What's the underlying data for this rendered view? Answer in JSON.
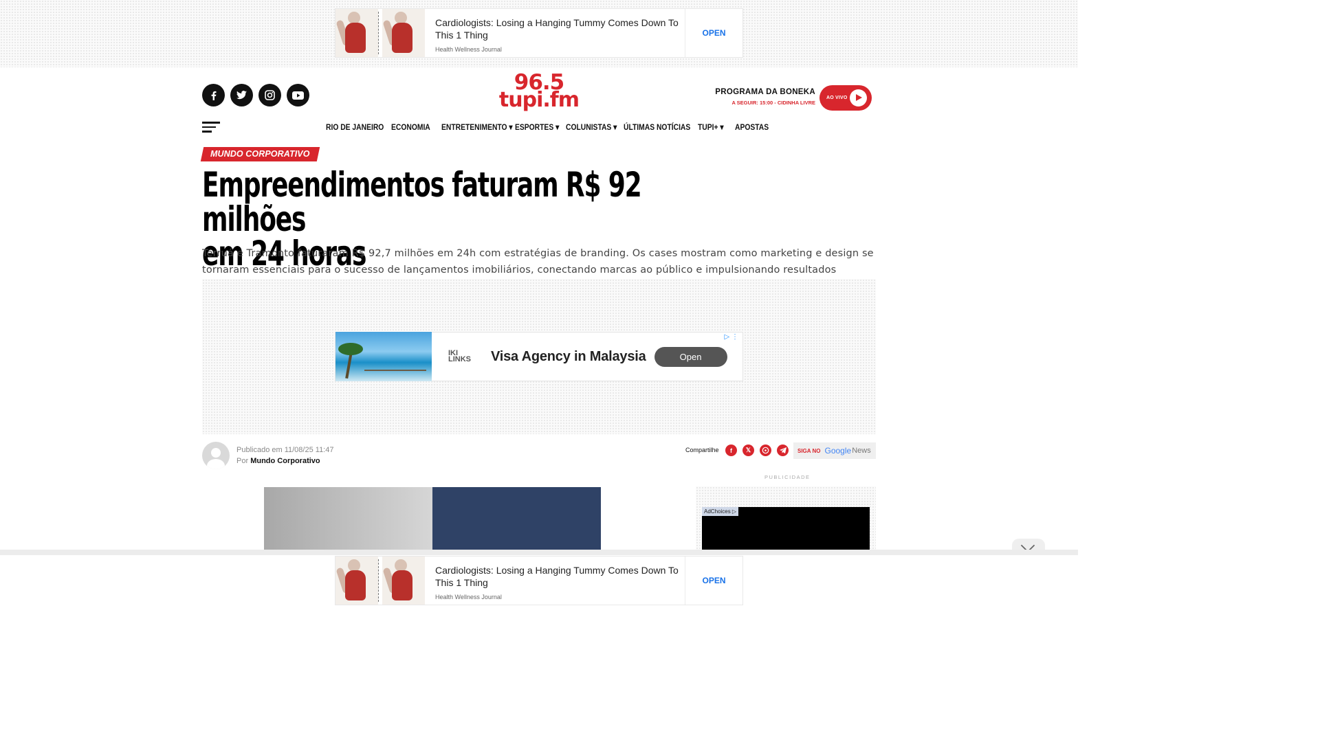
{
  "ads": {
    "top": {
      "headline": "Cardiologists: Losing a Hanging Tummy Comes Down To This 1 Thing",
      "source": "Health Wellness Journal",
      "cta": "OPEN"
    },
    "middle": {
      "brand": "IKI LINKS",
      "headline": "Visa Agency in Malaysia",
      "cta": "Open"
    },
    "bottom": {
      "headline": "Cardiologists: Losing a Hanging Tummy Comes Down To This 1 Thing",
      "source": "Health Wellness Journal",
      "cta": "OPEN"
    },
    "side": {
      "label": "PUBLICIDADE",
      "adchoices": "AdChoices"
    }
  },
  "header": {
    "logo_line1": "96.5",
    "logo_line2": "tupi.fm",
    "program_name": "PROGRAMA DA BONEKA",
    "program_next": "A SEGUIR: 15:00 - CIDINHA LIVRE",
    "live_label": "AO VIVO",
    "social_icons": [
      "facebook-icon",
      "twitter-icon",
      "instagram-icon",
      "youtube-icon"
    ]
  },
  "nav": {
    "items": [
      "RIO DE JANEIRO",
      "ECONOMIA",
      "ENTRETENIMENTO ▾",
      "ESPORTES ▾",
      "COLUNISTAS ▾",
      "ÚLTIMAS NOTÍCIAS",
      "TUPI+ ▾",
      "APOSTAS"
    ]
  },
  "article": {
    "category": "MUNDO CORPORATIVO",
    "title_line1": "Empreendimentos faturam R$ 92 milhões",
    "title_line2": "em 24 horas",
    "dek": "Terruá e Tramonto faturaram R$ 92,7 milhões em 24h com estratégias de branding. Os cases mostram como marketing e design se tornaram essenciais para o sucesso de lançamentos imobiliários, conectando marcas ao público e impulsionando resultados financeiros",
    "published": "Publicado em 11/08/25 11:47",
    "by_prefix": "Por",
    "author": "Mundo Corporativo",
    "share_label": "Compartilhe",
    "google_news_prefix": "SIGA NO",
    "google_word": "Google",
    "news_word": "News"
  },
  "colors": {
    "brand_red": "#d8262d",
    "dark": "#111111"
  }
}
